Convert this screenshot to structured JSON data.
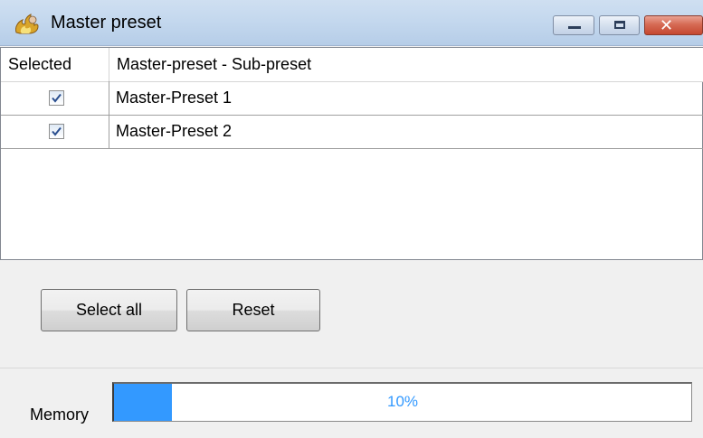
{
  "window": {
    "title": "Master preset",
    "icon": "flame-app-icon",
    "controls": [
      "minimize-icon",
      "maximize-icon",
      "close-icon"
    ]
  },
  "grid": {
    "columns": [
      "Selected",
      "Master-preset - Sub-preset"
    ],
    "rows": [
      {
        "selected": true,
        "name": "Master-Preset 1"
      },
      {
        "selected": true,
        "name": "Master-Preset 2"
      }
    ]
  },
  "buttons": {
    "select_all": "Select all",
    "reset": "Reset"
  },
  "memory": {
    "label": "Memory",
    "percent": 10,
    "text": "10%"
  },
  "colors": {
    "accent": "#3399ff",
    "titlebar": "#c4d8ee",
    "close_button": "#c5472f"
  }
}
